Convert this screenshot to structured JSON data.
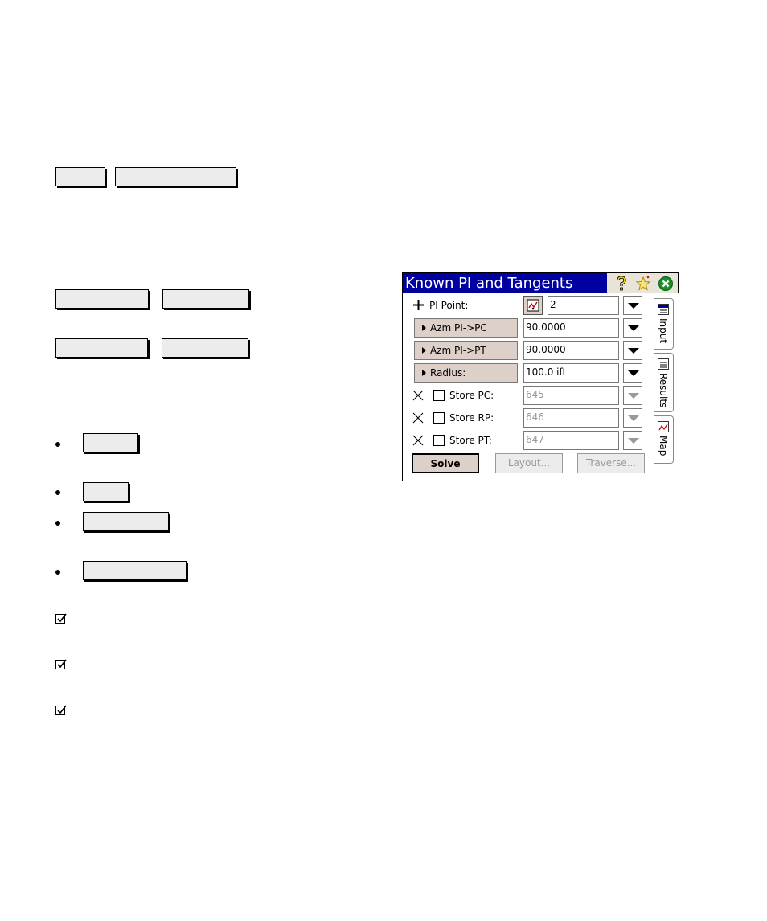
{
  "dialog": {
    "title": "Known PI and Tangents",
    "pi_point_label": "PI Point:",
    "pi_point_value": "2",
    "azm_pc_label": "Azm PI->PC",
    "azm_pc_value": "90.0000",
    "azm_pt_label": "Azm PI->PT",
    "azm_pt_value": "90.0000",
    "radius_label": "Radius:",
    "radius_value": "100.0 ift",
    "store_pc_label": "Store PC:",
    "store_pc_value": "645",
    "store_rp_label": "Store RP:",
    "store_rp_value": "646",
    "store_pt_label": "Store PT:",
    "store_pt_value": "647",
    "solve_label": "Solve",
    "layout_label": "Layout...",
    "traverse_label": "Traverse...",
    "tabs": {
      "input": "Input",
      "results": "Results",
      "map": "Map"
    }
  },
  "icons": {
    "help": "question-mark-icon",
    "favorite": "star-icon",
    "close": "close-circle-icon",
    "map_pick": "map-pick-icon"
  },
  "colors": {
    "titlebar": "#0000a0",
    "button_face": "#ddd0c8",
    "close_green": "#1a8f2a"
  }
}
